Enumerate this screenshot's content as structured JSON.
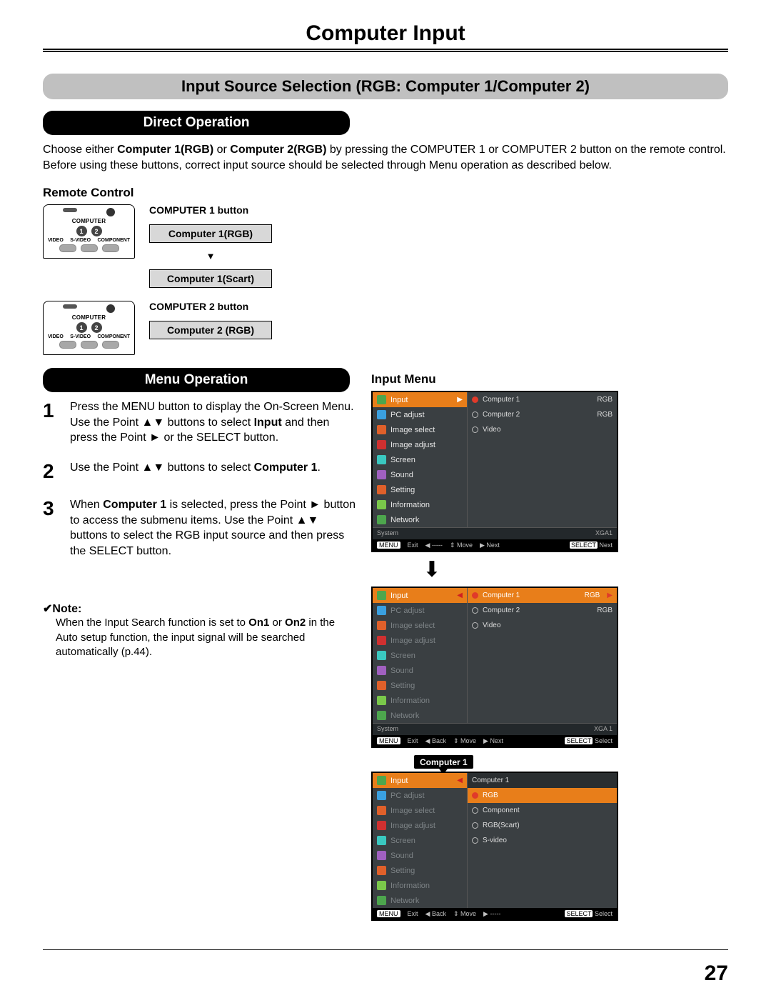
{
  "page": {
    "title": "Computer Input",
    "number": "27"
  },
  "section_bar": "Input Source Selection (RGB: Computer 1/Computer 2)",
  "direct_op": {
    "heading": "Direct Operation",
    "text1a": "Choose either ",
    "text1b": "Computer 1(RGB)",
    "text1c": " or ",
    "text1d": "Computer 2(RGB)",
    "text1e": " by pressing the COMPUTER 1 or COMPUTER 2 button on the remote control.",
    "text2": "Before using these buttons, correct input source should be selected through Menu operation as described below."
  },
  "remote": {
    "heading": "Remote Control",
    "comp1_label": "COMPUTER 1 button",
    "comp1_mode1": "Computer 1(RGB)",
    "comp1_mode2": "Computer 1(Scart)",
    "comp2_label": "COMPUTER 2 button",
    "comp2_mode1": "Computer 2 (RGB)",
    "pad_computer": "COMPUTER",
    "pad_video": "VIDEO",
    "pad_svideo": "S-VIDEO",
    "pad_component": "COMPONENT"
  },
  "menu_op": {
    "heading": "Menu Operation",
    "step1a": "Press the MENU button to display the On-Screen Menu. Use the Point ▲▼ buttons to select ",
    "step1b": "Input",
    "step1c": " and then press the Point ► or the SELECT button.",
    "step2a": "Use the Point ▲▼ buttons to select ",
    "step2b": "Computer 1",
    "step2c": ".",
    "step3a": "When ",
    "step3b": "Computer 1",
    "step3c": " is selected, press the Point ► button to access the submenu items. Use the Point ▲▼ buttons to select the RGB input source and then press the SELECT button."
  },
  "note": {
    "heading": "✔Note:",
    "text_a": "When the Input Search function is set to ",
    "text_b": "On1",
    "text_c": " or ",
    "text_d": "On2",
    "text_e": " in the Auto setup function, the input signal will be searched automatically (p.44)."
  },
  "input_menu": {
    "heading": "Input Menu",
    "callout": "Computer 1",
    "left_items": [
      "Input",
      "PC adjust",
      "Image select",
      "Image adjust",
      "Screen",
      "Sound",
      "Setting",
      "Information",
      "Network"
    ],
    "panel1_right": [
      {
        "label": "Computer 1",
        "val": "RGB",
        "on": true
      },
      {
        "label": "Computer 2",
        "val": "RGB",
        "on": false
      },
      {
        "label": "Video",
        "val": "",
        "on": false
      }
    ],
    "panel1_sys_l": "System",
    "panel1_sys_r": "XGA1",
    "panel2_right": [
      {
        "label": "Computer 1",
        "val": "RGB",
        "on": true,
        "arrow": true
      },
      {
        "label": "Computer 2",
        "val": "RGB",
        "on": false
      },
      {
        "label": "Video",
        "val": "",
        "on": false
      }
    ],
    "panel2_sys_l": "System",
    "panel2_sys_r": "XGA 1",
    "panel3_right_header": "Computer 1",
    "panel3_right": [
      {
        "label": "RGB",
        "on": true
      },
      {
        "label": "Component",
        "on": false
      },
      {
        "label": "RGB(Scart)",
        "on": false
      },
      {
        "label": "S-video",
        "on": false
      }
    ],
    "status": {
      "menu": "MENU",
      "exit": "Exit",
      "back": "Back",
      "dashes": "-----",
      "move": "Move",
      "next": "Next",
      "sel": "SELECT",
      "select": "Select"
    }
  }
}
